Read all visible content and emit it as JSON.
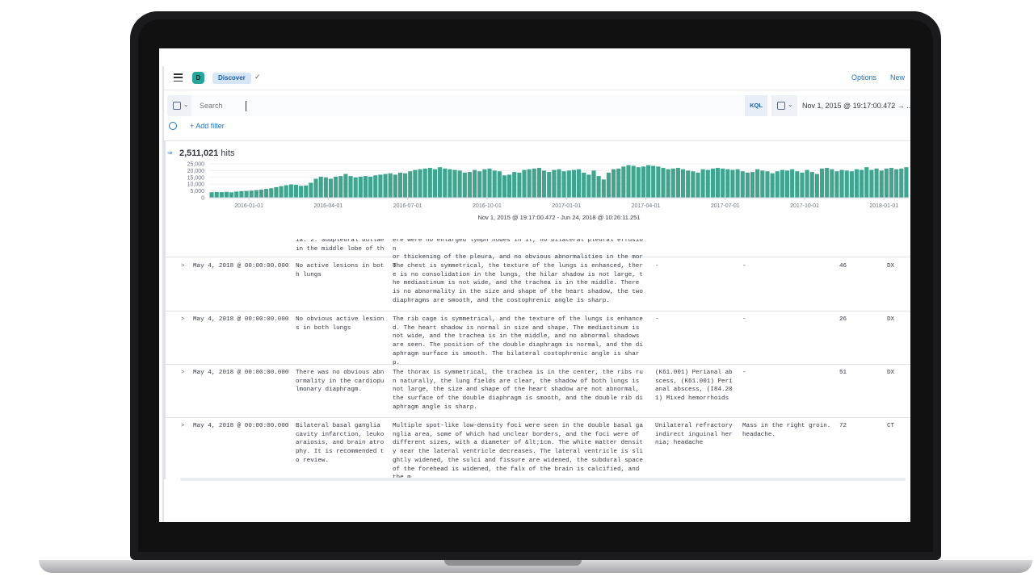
{
  "header": {
    "app_initial": "D",
    "breadcrumb": "Discover",
    "check": "✓",
    "options_label": "Options",
    "new_label": "New"
  },
  "query": {
    "placeholder": "Search",
    "language_label": "KQL",
    "date_range_text": "Nov 1, 2015 @ 19:17:00.472  →  ..."
  },
  "filters": {
    "add_filter_label": "+ Add filter"
  },
  "hits": {
    "count": "2,511,021",
    "label": "hits"
  },
  "chart_data": {
    "type": "bar",
    "title": "",
    "xlabel": "Nov 1, 2015 @ 19:17:00.472 - Jun 24, 2018 @ 10:26:11.251",
    "ylabel": "",
    "ylim": [
      0,
      25000
    ],
    "y_ticks": [
      "25,000",
      "20,000",
      "15,000",
      "10,000",
      "5,000",
      "0"
    ],
    "x_ticks": [
      "2016-01-01",
      "2016-04-01",
      "2016-07-01",
      "2016-10-01",
      "2017-01-01",
      "2017-04-01",
      "2017-07-01",
      "2017-10-01",
      "2018-01-01"
    ],
    "x_tick_bar_index": [
      8,
      24,
      40,
      56,
      72,
      88,
      104,
      120,
      136
    ],
    "color": "#3fa58f",
    "grid": true,
    "values": [
      4000,
      4200,
      4100,
      4300,
      4000,
      4500,
      4800,
      5000,
      5200,
      5600,
      6000,
      6500,
      7000,
      7800,
      8500,
      9200,
      9800,
      9500,
      8700,
      9000,
      11000,
      14000,
      15500,
      15000,
      14000,
      15500,
      16000,
      17500,
      16000,
      15000,
      15500,
      16000,
      15500,
      16500,
      17000,
      17500,
      18000,
      17000,
      18500,
      18000,
      19500,
      20500,
      21000,
      21500,
      22000,
      21000,
      22500,
      21500,
      21000,
      20500,
      20000,
      18500,
      19000,
      20500,
      19500,
      21000,
      21500,
      20000,
      19500,
      16500,
      17000,
      19000,
      18500,
      20500,
      21000,
      21500,
      22000,
      20000,
      19000,
      20500,
      21000,
      19500,
      20000,
      20500,
      21000,
      18500,
      17000,
      20000,
      16000,
      13500,
      18500,
      21000,
      21500,
      23000,
      24000,
      23500,
      22500,
      23000,
      24000,
      23500,
      23000,
      22000,
      21000,
      21500,
      22000,
      21000,
      20000,
      19500,
      18500,
      21000,
      20500,
      21500,
      22000,
      21500,
      21000,
      20500,
      21000,
      19500,
      18500,
      19000,
      21000,
      20000,
      19500,
      18000,
      19500,
      20500,
      20000,
      21000,
      19500,
      18500,
      20500,
      19000,
      17500,
      21500,
      22000,
      21000,
      19500,
      20500,
      20000,
      19500,
      21000,
      20500,
      22500,
      20500,
      21500,
      20000,
      21500,
      22000,
      21000,
      21500,
      22500
    ]
  },
  "table": {
    "partial_row": {
      "c1": "ia. 2. Subpleural bullae\nin the middle lobe of th",
      "c2": "ere were no enlarged lymph nodes in it, no bilateral pleural effusion\nor thickening of the pleura, and no obvious abnormalities in the moro"
    },
    "rows": [
      {
        "expand": ">",
        "time": "May 4, 2018 @ 00:00:00.000",
        "c1": "No active lesions in both lungs",
        "c2": "The chest is symmetrical, the texture of the lungs is enhanced, there is no consolidation in the lungs, the hilar shadow is not large, the mediastinum is not wide, and the trachea is in the middle. There is no abnormality in the size and shape of the heart shadow, the two diaphragms are smooth, and the costophrenic angle is sharp.",
        "c3": "-",
        "c4": "-",
        "c5": "46",
        "c6": "DX"
      },
      {
        "expand": ">",
        "time": "May 4, 2018 @ 00:00:00.000",
        "c1": "No obvious active lesions in both lungs",
        "c2": "The rib cage is symmetrical, and the texture of the lungs is enhanced. The heart shadow is normal in size and shape. The mediastinum is not wide, and the trachea is in the middle, and no abnormal shadows are seen. The position of the double diaphragm is normal, and the diaphragm surface is smooth. The bilateral costophrenic angle is sharp.",
        "c3": "-",
        "c4": "-",
        "c5": "26",
        "c6": "DX"
      },
      {
        "expand": ">",
        "time": "May 4, 2018 @ 00:00:00.000",
        "c1": "There was no obvious abnormality in the cardiopulmonary diaphragm.",
        "c2": "The thorax is symmetrical, the trachea is in the center, the ribs run naturally, the lung fields are clear, the shadow of both lungs is not large, the size and shape of the heart shadow are not abnormal, the surface of the double diaphragm is smooth, and the double rib diaphragm angle is sharp.",
        "c3": "(K61.001) Perianal abscess, (K61.001) Perianal abscess, (I84.201) Mixed hemorrhoids",
        "c4": "-",
        "c5": "51",
        "c6": "DX"
      },
      {
        "expand": ">",
        "time": "May 4, 2018 @ 00:00:00.000",
        "c1": "Bilateral basal ganglia cavity infarction, leukoaraiosis, and brain atrophy. It is recommended to review.",
        "c2": "Multiple spot-like low-density foci were seen in the double basal ganglia area, some of which had unclear borders, and the foci were of different sizes, with a diameter of &lt;1cm. The white matter density near the lateral ventricle decreases. The lateral ventricle is slightly widened, the sulci and fissure are widened, the subdural space of the forehead is widened, the falx of the brain is calcified, and the m",
        "c3": "Unilateral refractory indirect inguinal hernia; headache",
        "c4": "Mass in the right groin. headache.",
        "c5": "72",
        "c6": "CT"
      }
    ]
  }
}
